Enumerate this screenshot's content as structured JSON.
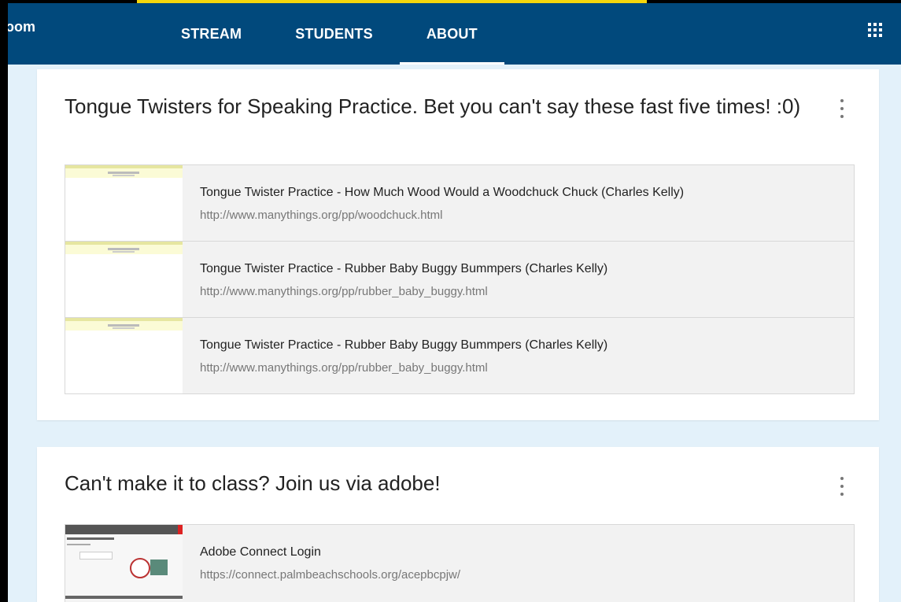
{
  "header": {
    "brand_fragment": "ɔom",
    "tabs": [
      {
        "label": "STREAM",
        "active": false
      },
      {
        "label": "STUDENTS",
        "active": false
      },
      {
        "label": "ABOUT",
        "active": true
      }
    ],
    "apps_icon": "apps-grid-icon"
  },
  "cards": [
    {
      "title": "Tongue Twisters for Speaking Practice. Bet you can't say these fast five times! :0)",
      "menu_icon": "more-vert-icon",
      "attachments": [
        {
          "title": "Tongue Twister Practice - How Much Wood Would a Woodchuck Chuck (Charles Kelly)",
          "url": "http://www.manythings.org/pp/woodchuck.html"
        },
        {
          "title": "Tongue Twister Practice - Rubber Baby Buggy Bummpers (Charles Kelly)",
          "url": "http://www.manythings.org/pp/rubber_baby_buggy.html"
        },
        {
          "title": "Tongue Twister Practice - Rubber Baby Buggy Bummpers (Charles Kelly)",
          "url": "http://www.manythings.org/pp/rubber_baby_buggy.html"
        }
      ]
    },
    {
      "title": "Can't make it to class? Join us via adobe!",
      "menu_icon": "more-vert-icon",
      "attachments": [
        {
          "title": "Adobe Connect Login",
          "url": "https://connect.palmbeachschools.org/acepbcpjw/"
        }
      ]
    }
  ],
  "colors": {
    "appbar": "#01497c",
    "background": "#e3f1fa",
    "accent_strip": "#f5d60b"
  }
}
